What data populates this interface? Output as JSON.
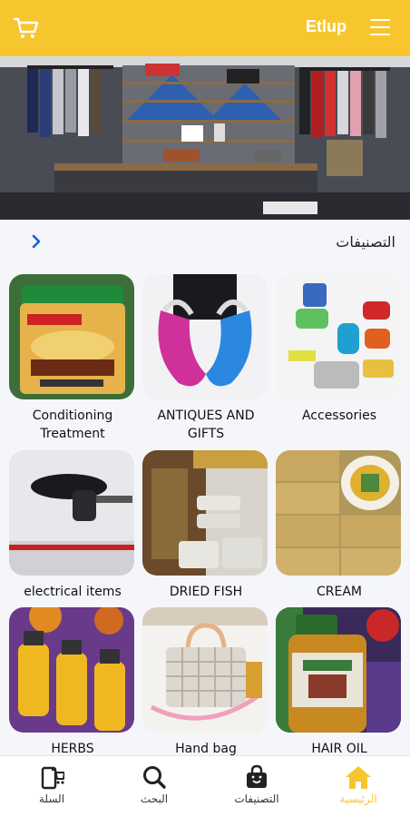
{
  "header": {
    "brand": "Etlup",
    "cart_icon": "cart-icon",
    "menu_icon": "hamburger-menu-icon",
    "bar_color": "#f7c62f"
  },
  "categories": {
    "title": "التصنيفات",
    "more_icon": "chevron-right-icon",
    "items": [
      {
        "label": "Conditioning Treatment"
      },
      {
        "label": "ANTIQUES AND GIFTS"
      },
      {
        "label": "Accessories"
      },
      {
        "label": "electrical items"
      },
      {
        "label": "DRIED FISH"
      },
      {
        "label": "CREAM"
      },
      {
        "label": "HERBS"
      },
      {
        "label": "Hand bag"
      },
      {
        "label": "HAIR OIL"
      }
    ]
  },
  "bottom_nav": {
    "cart": {
      "label": "السلة",
      "icon": "cart-icon"
    },
    "search": {
      "label": "البحث",
      "icon": "search-icon"
    },
    "categories": {
      "label": "التصنيفات",
      "icon": "shopping-bag-icon"
    },
    "home": {
      "label": "الرئيسية",
      "icon": "home-icon",
      "active": true
    },
    "active_color": "#f7c62f"
  }
}
